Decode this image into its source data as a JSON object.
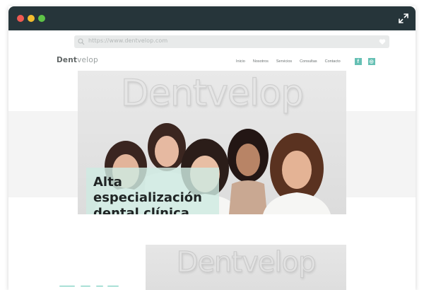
{
  "browser": {
    "url": "https://www.dentvelop.com"
  },
  "site": {
    "logo_part1": "Dent",
    "logo_part2": "velop",
    "nav": [
      "Inicio",
      "Nosotros",
      "Servicios",
      "Consultas",
      "Contacto"
    ],
    "social": [
      {
        "icon": "facebook-icon",
        "glyph": "f"
      },
      {
        "icon": "instagram-icon",
        "glyph": "◎"
      }
    ]
  },
  "hero": {
    "wall_logo": "Dentvelop",
    "title": "Alta especialización dental clínica"
  },
  "second": {
    "wall_logo": "Dentvelop"
  },
  "colors": {
    "titlebar": "#26353a",
    "accent": "#66c0b4",
    "caption_bg": "#ceeae2"
  }
}
